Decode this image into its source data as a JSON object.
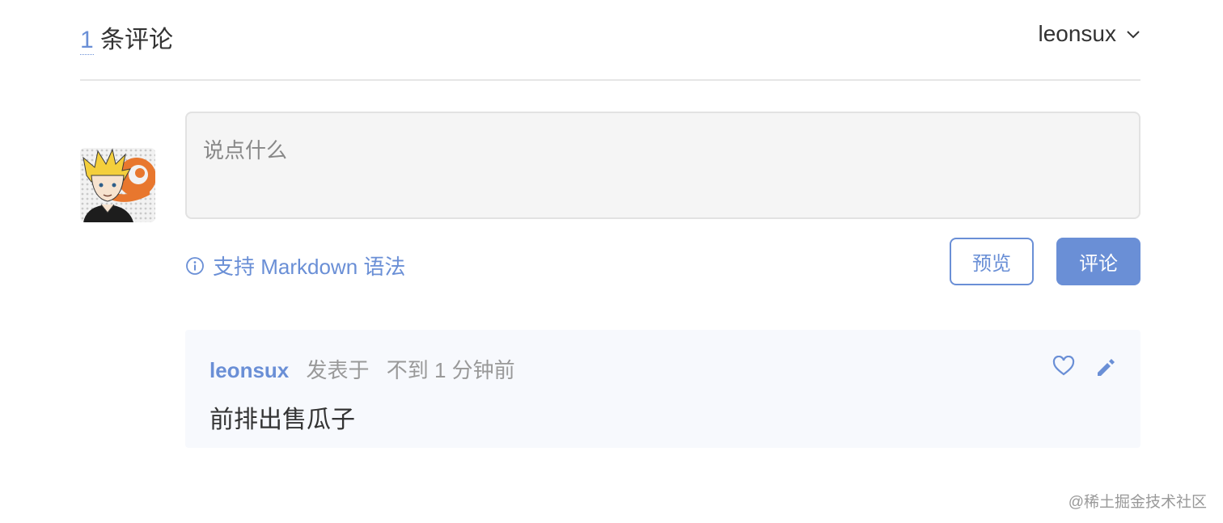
{
  "header": {
    "count": "1",
    "count_label": "条评论",
    "username": "leonsux",
    "menu_icon": "chevron-down-icon"
  },
  "editor": {
    "placeholder": "说点什么"
  },
  "hint": {
    "icon": "info-icon",
    "text": "支持 Markdown 语法"
  },
  "buttons": {
    "preview": "预览",
    "submit": "评论"
  },
  "comment": {
    "author": "leonsux",
    "action": "发表于",
    "time": "不到 1 分钟前",
    "body": "前排出售瓜子",
    "icons": [
      "heart-icon",
      "pencil-icon"
    ]
  },
  "watermark": "@稀土掘金技术社区",
  "colors": {
    "accent": "#6a8fd6",
    "editor_bg": "#f5f5f5",
    "comment_bg": "#f7f9fd"
  }
}
